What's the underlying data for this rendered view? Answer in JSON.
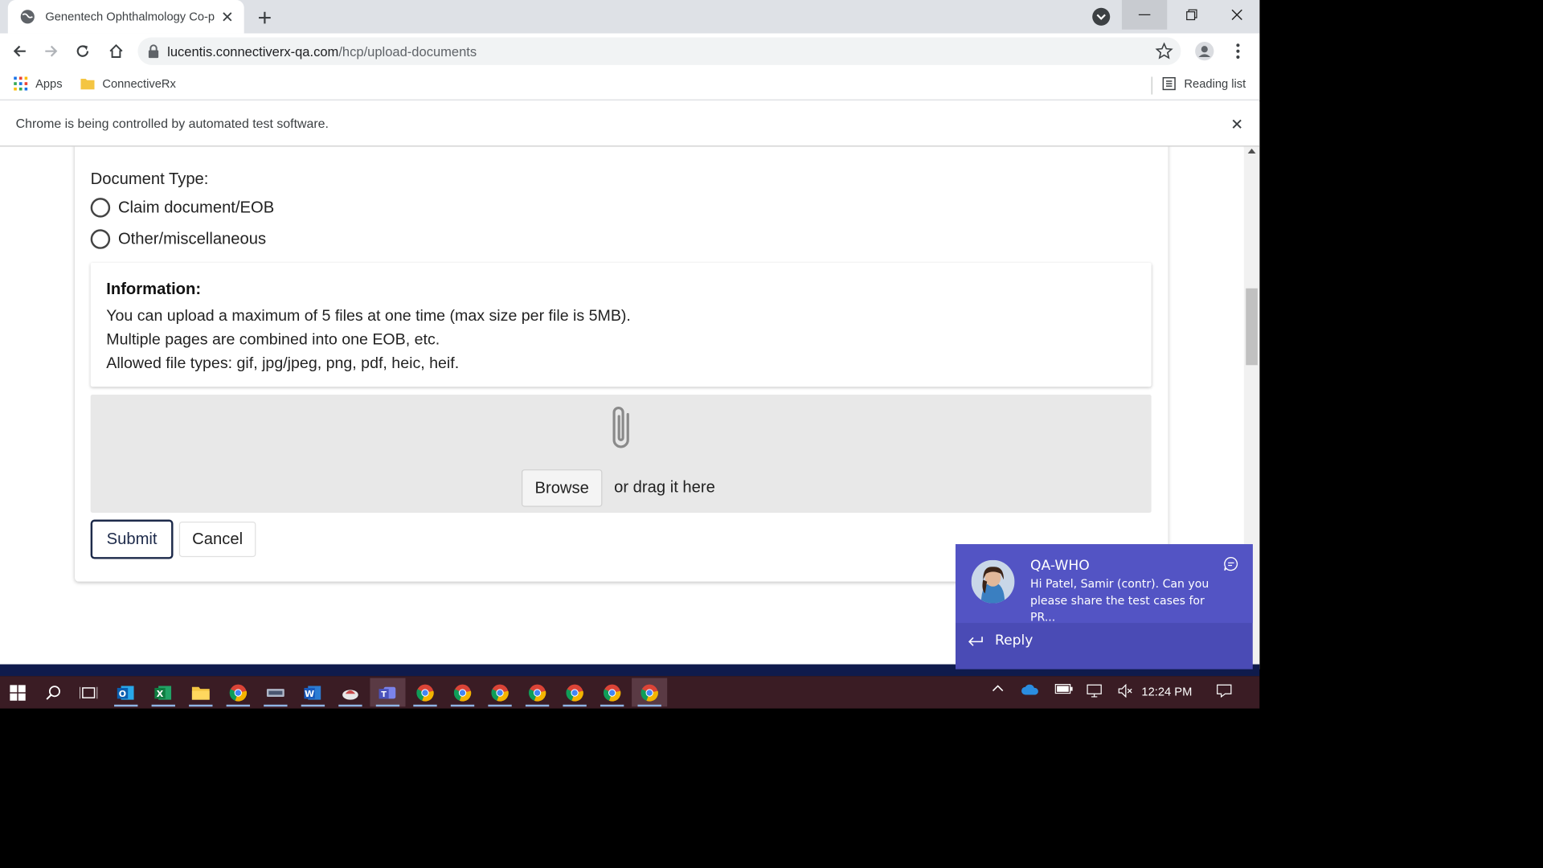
{
  "browser": {
    "tab_title": "Genentech Ophthalmology Co-p",
    "url_host": "lucentis.connectiverx-qa.com",
    "url_path": "/hcp/upload-documents",
    "bookmarks": {
      "apps": "Apps",
      "connectiverx": "ConnectiveRx",
      "reading_list": "Reading list"
    },
    "infobar_text": "Chrome is being controlled by automated test software."
  },
  "form": {
    "document_type_label": "Document Type:",
    "options": [
      "Claim document/EOB",
      "Other/miscellaneous"
    ],
    "info_title": "Information:",
    "info_lines": [
      "You can upload a maximum of 5 files at one time (max size per file is 5MB).",
      "Multiple pages are combined into one EOB, etc.",
      "Allowed file types: gif, jpg/jpeg, png, pdf, heic, heif."
    ],
    "browse_label": "Browse",
    "drag_text": "or drag it here",
    "submit_label": "Submit",
    "cancel_label": "Cancel"
  },
  "notification": {
    "sender": "QA-WHO",
    "message": "Hi Patel, Samir (contr). Can you please share the test cases for PR...",
    "reply_label": "Reply"
  },
  "taskbar": {
    "clock": "12:24 PM",
    "apps": [
      "outlook-icon",
      "excel-icon",
      "file-explorer-icon",
      "chrome-icon",
      "app-icon",
      "word-icon",
      "app-icon",
      "teams-icon",
      "chrome-icon",
      "chrome-icon",
      "chrome-icon",
      "chrome-icon",
      "chrome-icon",
      "chrome-icon",
      "chrome-icon"
    ]
  },
  "colors": {
    "toast_bg": "#4a4bb5",
    "taskbar_bg": "#3a1c24",
    "submit_border": "#1d2a4a",
    "dropzone_bg": "#e8e8e8"
  }
}
